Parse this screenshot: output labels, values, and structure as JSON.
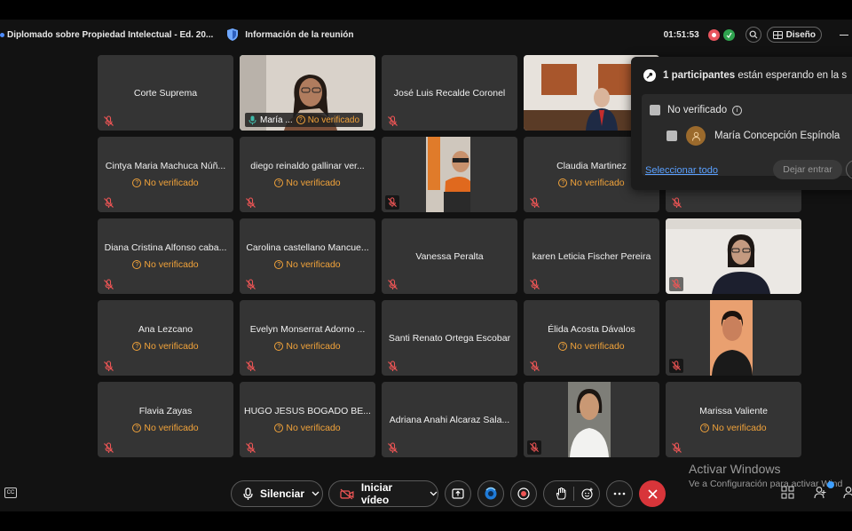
{
  "titlebar": {
    "meeting_title": "Diplomado sobre Propiedad Intelectual - Ed. 20...",
    "info_label": "Información de la reunión",
    "timer": "01:51:53",
    "layout_label": "Diseño"
  },
  "tiles": {
    "unverified_label": "No verificado",
    "t1": {
      "name": "Corte Suprema"
    },
    "t2": {
      "name": "María ..."
    },
    "t3": {
      "name": "José Luis Recalde Coronel"
    },
    "t6": {
      "name": "Cintya Maria Machuca Núñ..."
    },
    "t7": {
      "name": "diego reinaldo gallinar ver..."
    },
    "t9": {
      "name": "Claudia Martinez"
    },
    "t11": {
      "name": "Diana Cristina Alfonso caba..."
    },
    "t12": {
      "name": "Carolina castellano Mancue..."
    },
    "t13": {
      "name": "Vanessa Peralta"
    },
    "t14": {
      "name": "karen Leticia Fischer Pereira"
    },
    "t16": {
      "name": "Ana Lezcano"
    },
    "t17": {
      "name": "Evelyn  Monserrat Adorno ..."
    },
    "t18": {
      "name": "Santi Renato Ortega Escobar"
    },
    "t19": {
      "name": "Élida Acosta Dávalos"
    },
    "t21": {
      "name": "Flavia Zayas"
    },
    "t22": {
      "name": "HUGO JESUS BOGADO BE..."
    },
    "t23": {
      "name": "Adriana Anahi Alcaraz Sala..."
    },
    "t25": {
      "name": "Marissa Valiente"
    }
  },
  "lobby": {
    "count": "1 participantes",
    "message": " están esperando en la s",
    "group_label": "No verificado",
    "person_name": "María Concepción Espínola",
    "select_all": "Seleccionar todo",
    "admit_label": "Dejar entrar"
  },
  "controls": {
    "mute_label": "Silenciar",
    "video_label": "Iniciar vídeo",
    "cc_label": "CC"
  },
  "watermark": {
    "title": "Activar Windows",
    "subtitle": "Ve a Configuración para activar Wind"
  },
  "colors": {
    "accent_green": "#3fb9a9",
    "unverified_orange": "#f2a33a",
    "leave_red": "#d8353a",
    "link_blue": "#5aa0ff"
  },
  "icons": [
    "shield-icon",
    "record-icon",
    "magnify-icon",
    "layout-icon",
    "mic-muted-icon",
    "key-icon",
    "info-icon",
    "person-icon",
    "mic-icon",
    "video-off-icon",
    "share-icon",
    "ai-assistant-icon",
    "record-button-icon",
    "raise-hand-icon",
    "reactions-icon",
    "more-icon",
    "close-icon",
    "participants-icon",
    "person-add-icon",
    "chat-icon"
  ]
}
